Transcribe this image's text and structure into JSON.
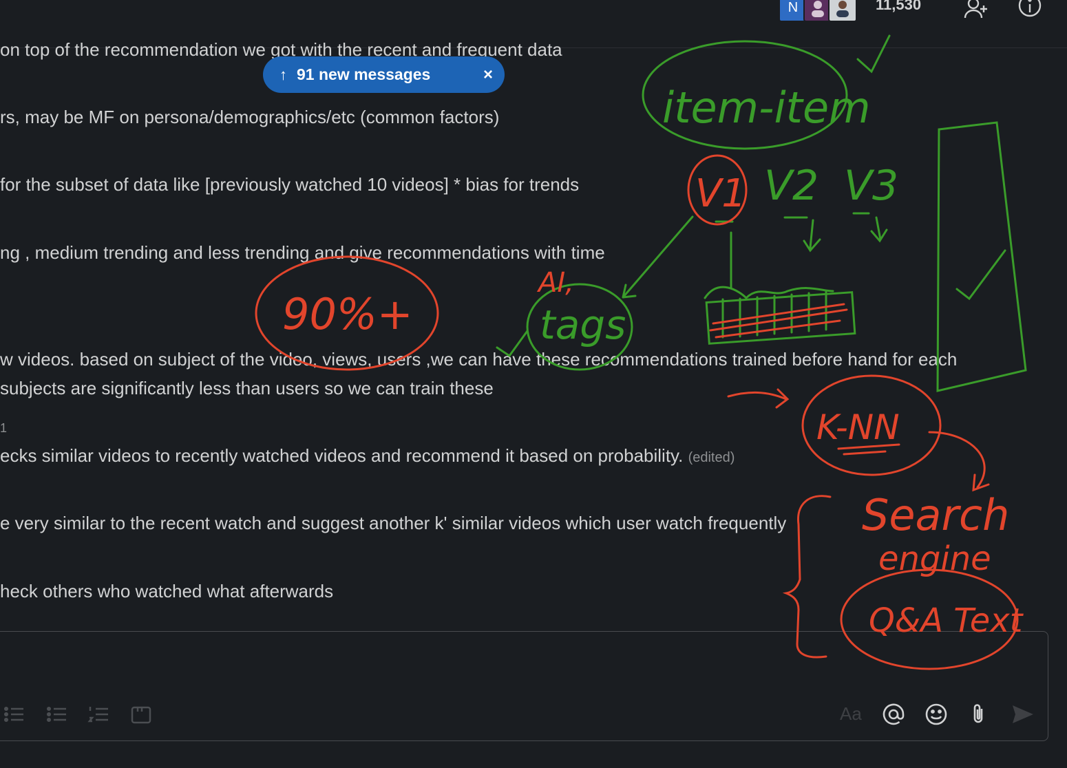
{
  "header": {
    "avatar_initial": "N",
    "member_count": "11,530",
    "icons": [
      "add-member-icon",
      "info-icon"
    ]
  },
  "new_messages_pill": {
    "arrow": "↑",
    "label": "91 new messages",
    "close": "×"
  },
  "messages": [
    "on top of the recommendation we got with the recent and frequent data",
    "rs, may be MF on persona/demographics/etc (common factors)",
    " for the subset of data like [previously watched 10 videos] * bias for trends",
    "ng , medium trending and less trending and give recommendations with time",
    "w videos. based on subject of the video, views, users ,we can have these recommendations trained before hand for each",
    " subjects are significantly less than users so we can train these",
    "ecks similar videos to recently watched videos and recommend it based on probability.",
    "e very similar to the recent watch and suggest another k' similar videos which user watch frequently",
    "heck others who watched what afterwards"
  ],
  "edited_label": "(edited)",
  "small_fragment": "1",
  "composer": {
    "format_icons": [
      "bullet-list-icon",
      "numbered-list-icon",
      "ordered-list-icon",
      "code-block-icon"
    ],
    "aa_label": "Aa",
    "action_icons": [
      "mention-icon",
      "emoji-icon",
      "attach-icon",
      "send-icon"
    ]
  },
  "annotations": {
    "item_item": "item-item",
    "v1": "V1",
    "v2": "V2",
    "v3": "V3",
    "ninety": "90%+",
    "ai": "AI,",
    "tags": "tags",
    "knn": "K-NN",
    "search": "Search",
    "engine": "engine",
    "qa_text": "Q&A Text",
    "green_color": "#3a9c2a",
    "red_color": "#e2452c"
  }
}
